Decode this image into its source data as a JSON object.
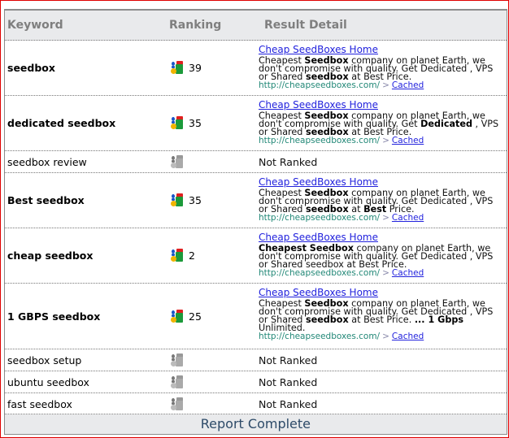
{
  "header": {
    "keyword": "Keyword",
    "ranking": "Ranking",
    "result": "Result Detail"
  },
  "rows": [
    {
      "keyword": "seedbox",
      "ranked": true,
      "rank": "39",
      "title": "Cheap SeedBoxes Home",
      "snippet": [
        {
          "t": "Cheapest "
        },
        {
          "t": "Seedbox",
          "b": true
        },
        {
          "t": " company on planet Earth, we don't compromise with quality. Get Dedicated , VPS or Shared "
        },
        {
          "t": "seedbox",
          "b": true
        },
        {
          "t": " at Best Price."
        }
      ],
      "url": "http://cheapseedboxes.com/",
      "sep": ">",
      "cached": "Cached"
    },
    {
      "keyword": "dedicated seedbox",
      "ranked": true,
      "rank": "35",
      "title": "Cheap SeedBoxes Home",
      "snippet": [
        {
          "t": "Cheapest "
        },
        {
          "t": "Seedbox",
          "b": true
        },
        {
          "t": " company on planet Earth, we don't compromise with quality. Get "
        },
        {
          "t": "Dedicated",
          "b": true
        },
        {
          "t": " , VPS or Shared "
        },
        {
          "t": "seedbox",
          "b": true
        },
        {
          "t": " at Best Price."
        }
      ],
      "url": "http://cheapseedboxes.com/",
      "sep": ">",
      "cached": "Cached"
    },
    {
      "keyword": "seedbox review",
      "ranked": false,
      "status": "Not Ranked"
    },
    {
      "keyword": "Best seedbox",
      "ranked": true,
      "rank": "35",
      "title": "Cheap SeedBoxes Home",
      "snippet": [
        {
          "t": "Cheapest "
        },
        {
          "t": "Seedbox",
          "b": true
        },
        {
          "t": " company on planet Earth, we don't compromise with quality. Get Dedicated , VPS or Shared "
        },
        {
          "t": "seedbox",
          "b": true
        },
        {
          "t": " at "
        },
        {
          "t": "Best",
          "b": true
        },
        {
          "t": " Price."
        }
      ],
      "url": "http://cheapseedboxes.com/",
      "sep": ">",
      "cached": "Cached"
    },
    {
      "keyword": "cheap seedbox",
      "ranked": true,
      "rank": "2",
      "title": "Cheap SeedBoxes Home",
      "snippet": [
        {
          "t": "Cheapest Seedbox",
          "b": true
        },
        {
          "t": " company on planet Earth, we don't compromise with quality. Get Dedicated , VPS or Shared seedbox at Best Price."
        }
      ],
      "url": "http://cheapseedboxes.com/",
      "sep": ">",
      "cached": "Cached"
    },
    {
      "keyword": "1 GBPS seedbox",
      "ranked": true,
      "rank": "25",
      "title": "Cheap SeedBoxes Home",
      "snippet": [
        {
          "t": "Cheapest "
        },
        {
          "t": "Seedbox",
          "b": true
        },
        {
          "t": " company on planet Earth, we don't compromise with quality. Get Dedicated , VPS or Shared "
        },
        {
          "t": "seedbox",
          "b": true
        },
        {
          "t": " at Best Price. "
        },
        {
          "t": "... 1 Gbps",
          "b": true
        },
        {
          "t": " Unlimited."
        }
      ],
      "url": "http://cheapseedboxes.com/",
      "sep": ">",
      "cached": "Cached"
    },
    {
      "keyword": "seedbox setup",
      "ranked": false,
      "status": "Not Ranked"
    },
    {
      "keyword": "ubuntu seedbox",
      "ranked": false,
      "status": "Not Ranked"
    },
    {
      "keyword": "fast seedbox",
      "ranked": false,
      "status": "Not Ranked"
    }
  ],
  "footer": {
    "status": "Report Complete"
  },
  "colors": {
    "border": "#e00000",
    "header_bg": "#e9eaec",
    "link": "#2222dd",
    "url": "#228877"
  }
}
